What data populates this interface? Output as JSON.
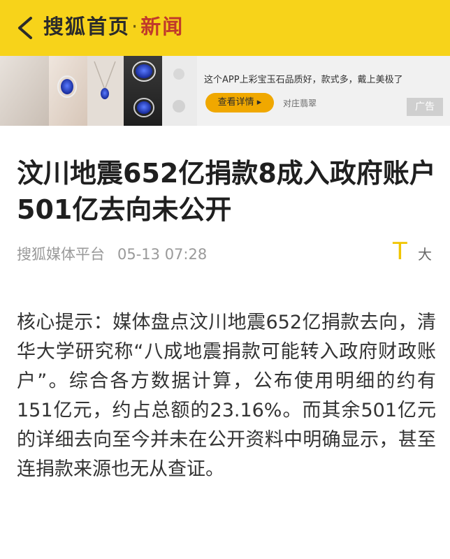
{
  "header": {
    "brand_main": "搜狐首页",
    "separator": "·",
    "section": "新闻",
    "background_color": "#f7d31a",
    "back_icon": "chevron-left-icon"
  },
  "ad": {
    "headline": "这个APP上彩宝玉石品质好，款式多，戴上美极了",
    "button_label": "查看详情 ▸",
    "source": "对庄翡翠",
    "tag": "广告",
    "button_color": "#f0a800"
  },
  "article": {
    "title": "汶川地震652亿捐款8成入政府账户 501亿去向未公开",
    "source": "搜狐媒体平台",
    "time": "05-13 07:28",
    "font_toggle_icon": "T",
    "font_toggle_label": "大",
    "body": "核心提示：媒体盘点汶川地震652亿捐款去向，清华大学研究称“八成地震捐款可能转入政府财政账户”。综合各方数据计算，公布使用明细的约有151亿元，约占总额的23.16%。而其余501亿元的详细去向至今并未在公开资料中明确显示，甚至连捐款来源也无从查证。"
  }
}
